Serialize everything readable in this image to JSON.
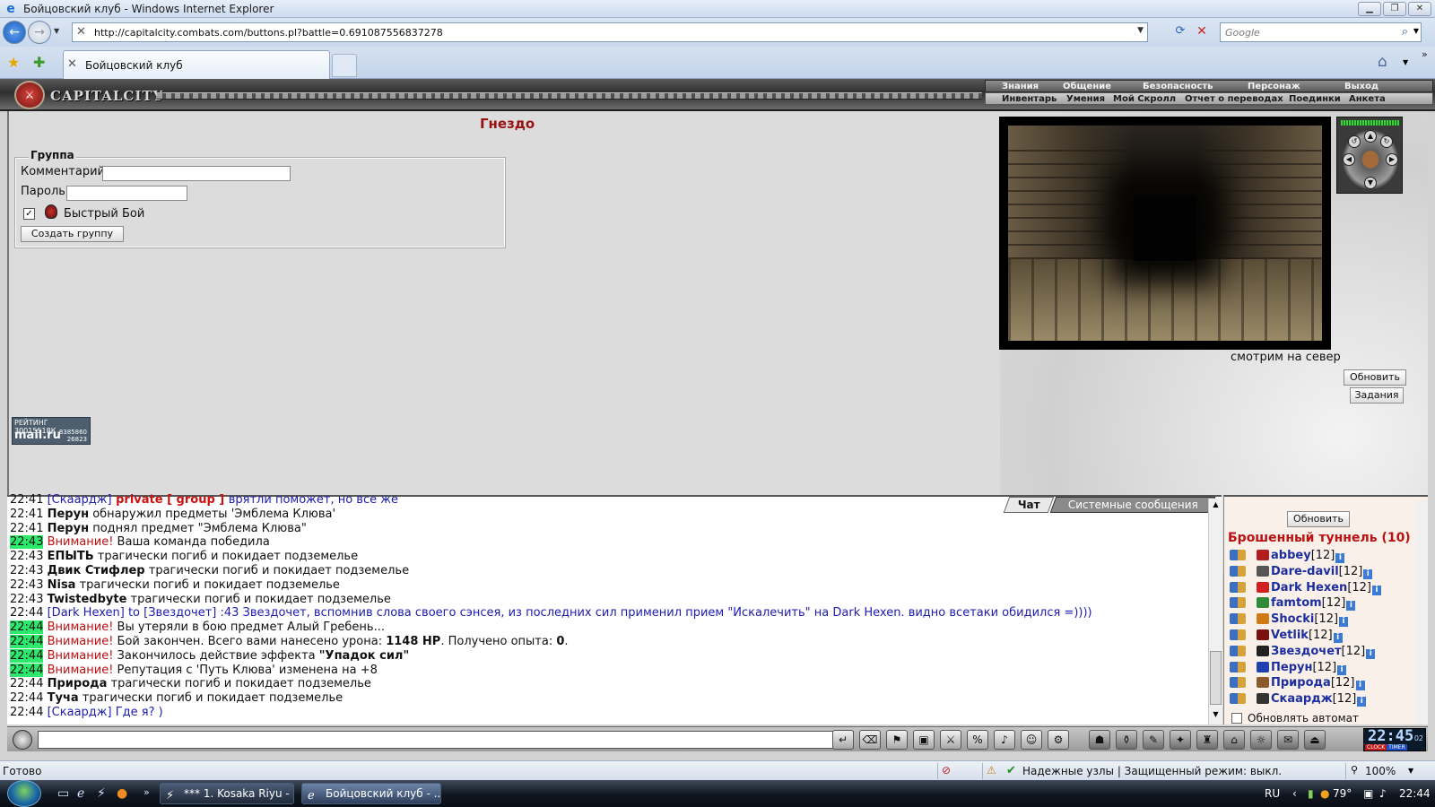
{
  "browser": {
    "window_title": "Бойцовский клуб - Windows Internet Explorer",
    "url": "http://capitalcity.combats.com/buttons.pl?battle=0.691087556837278",
    "search_placeholder": "Google",
    "tab_title": "Бойцовский клуб",
    "status_text": "Готово",
    "zone_text": "Надежные узлы | Защищенный режим: выкл.",
    "zoom": "100%"
  },
  "game": {
    "logo": "CAPITALCITY",
    "menu_top": [
      "Знания",
      "Общение",
      "Безопасность",
      "Персонаж",
      "Выход"
    ],
    "menu_bottom": [
      "Инвентарь",
      "Умения",
      "Мой Скролл",
      "Отчет о переводах",
      "Поединки",
      "Анкета"
    ],
    "location_title": "Гнездо",
    "group": {
      "legend": "Группа",
      "comment_label": "Комментарий",
      "password_label": "Пароль",
      "quick_fight_label": "Быстрый Бой",
      "create_button": "Создать группу"
    },
    "rating": {
      "top": "РЕЙТИНГ 30015518К",
      "brand": "mail.ru",
      "n1": "8385860",
      "n2": "26823"
    },
    "view_caption": "смотрим на север",
    "refresh_button": "Обновить",
    "tasks_button": "Задания"
  },
  "chat": {
    "tab_chat": "Чат",
    "tab_system": "Системные сообщения",
    "lines": [
      {
        "time": "22:41",
        "hl": false,
        "parts": [
          [
            "nick",
            "[Скаардж]"
          ],
          [
            "priv",
            " private [ group ] "
          ],
          [
            "blue",
            "врятли поможет, но все же"
          ]
        ]
      },
      {
        "time": "22:41",
        "hl": false,
        "parts": [
          [
            "b",
            "Перун"
          ],
          [
            "t",
            " обнаружил предметы 'Эмблема Клюва'"
          ]
        ]
      },
      {
        "time": "22:41",
        "hl": false,
        "parts": [
          [
            "b",
            "Перун"
          ],
          [
            "t",
            " поднял предмет \"Эмблема Клюва\""
          ]
        ]
      },
      {
        "time": "22:43",
        "hl": true,
        "parts": [
          [
            "warn",
            "Внимание!"
          ],
          [
            "t",
            " Ваша команда победила"
          ]
        ]
      },
      {
        "time": "22:43",
        "hl": false,
        "parts": [
          [
            "b",
            "ЕПЫТЬ"
          ],
          [
            "t",
            " трагически погиб и покидает подземелье"
          ]
        ]
      },
      {
        "time": "22:43",
        "hl": false,
        "parts": [
          [
            "b",
            "Двик Стифлер"
          ],
          [
            "t",
            " трагически погиб и покидает подземелье"
          ]
        ]
      },
      {
        "time": "22:43",
        "hl": false,
        "parts": [
          [
            "b",
            "Nisa"
          ],
          [
            "t",
            " трагически погиб и покидает подземелье"
          ]
        ]
      },
      {
        "time": "22:43",
        "hl": false,
        "parts": [
          [
            "b",
            "Twistedbyte"
          ],
          [
            "t",
            " трагически погиб и покидает подземелье"
          ]
        ]
      },
      {
        "time": "22:44",
        "hl": false,
        "parts": [
          [
            "nick",
            "[Dark Hexen]"
          ],
          [
            "blue",
            " to [Звездочет] :43 Звездочет, вспомнив слова своего сэнсея, из последних сил применил прием \"Искалечить\" на Dark Hexen. видно всетаки обидился =))))"
          ]
        ]
      },
      {
        "time": "22:44",
        "hl": true,
        "parts": [
          [
            "warn",
            "Внимание!"
          ],
          [
            "t",
            " Вы утеряли в бою предмет Алый Гребень..."
          ]
        ]
      },
      {
        "time": "22:44",
        "hl": true,
        "parts": [
          [
            "warn",
            "Внимание!"
          ],
          [
            "t",
            " Бой закончен. Всего вами нанесено урона: "
          ],
          [
            "b",
            "1148 HP"
          ],
          [
            "t",
            ". Получено опыта: "
          ],
          [
            "b",
            "0"
          ],
          [
            "t",
            "."
          ]
        ]
      },
      {
        "time": "22:44",
        "hl": true,
        "parts": [
          [
            "warn",
            "Внимание!"
          ],
          [
            "t",
            " Закончилось действие эффекта "
          ],
          [
            "b",
            "\"Упадок сил\""
          ]
        ]
      },
      {
        "time": "22:44",
        "hl": true,
        "parts": [
          [
            "warn",
            "Внимание!"
          ],
          [
            "t",
            " Репутация с 'Путь Клюва' изменена на +8"
          ]
        ]
      },
      {
        "time": "22:44",
        "hl": false,
        "parts": [
          [
            "b",
            "Природа"
          ],
          [
            "t",
            " трагически погиб и покидает подземелье"
          ]
        ]
      },
      {
        "time": "22:44",
        "hl": false,
        "parts": [
          [
            "b",
            "Туча"
          ],
          [
            "t",
            " трагически погиб и покидает подземелье"
          ]
        ]
      },
      {
        "time": "22:44",
        "hl": false,
        "parts": [
          [
            "nick",
            "[Скаардж]"
          ],
          [
            "blue",
            " Где я? )"
          ]
        ]
      }
    ]
  },
  "users": {
    "refresh": "Обновить",
    "room": "Брошенный туннель (10)",
    "list": [
      {
        "name": "abbey",
        "level": "[12]",
        "color": "#b31d1d"
      },
      {
        "name": "Dare-davil",
        "level": "[12]",
        "color": "#555555"
      },
      {
        "name": "Dark Hexen",
        "level": "[12]",
        "color": "#d02020"
      },
      {
        "name": "famtom",
        "level": "[12]",
        "color": "#2e8b3a"
      },
      {
        "name": "Shocki",
        "level": "[12]",
        "color": "#d07a16"
      },
      {
        "name": "Vetlik",
        "level": "[12]",
        "color": "#7a1010"
      },
      {
        "name": "Звездочет",
        "level": "[12]",
        "color": "#222222"
      },
      {
        "name": "Перун",
        "level": "[12]",
        "color": "#2040b0"
      },
      {
        "name": "Природа",
        "level": "[12]",
        "color": "#8a5a2a"
      },
      {
        "name": "Скаардж",
        "level": "[12]",
        "color": "#333333"
      }
    ],
    "auto_update": "Обновлять автомат"
  },
  "clock": {
    "time": "22:45",
    "sec": "02",
    "clock_label": "CLOCK",
    "timer_label": "TIMER"
  },
  "taskbar": {
    "btn1": "*** 1. Kosaka Riyu - ...",
    "btn2": "Бойцовский клуб - ...",
    "lang": "RU",
    "temp": "79°",
    "time": "22:44"
  }
}
